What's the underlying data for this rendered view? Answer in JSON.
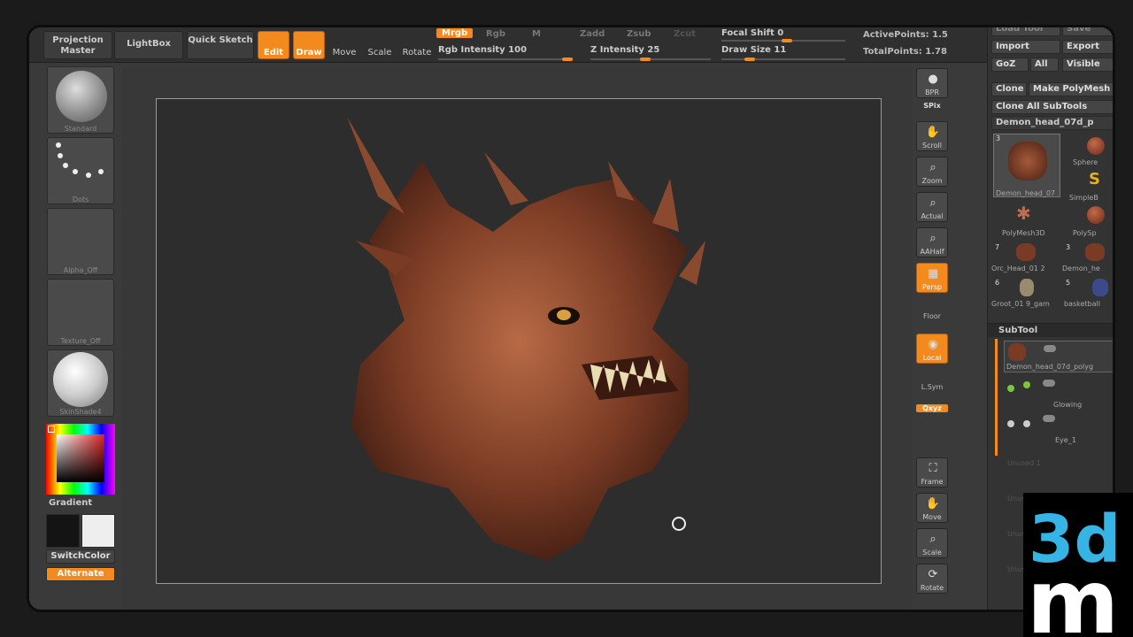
{
  "topbar": {
    "projection_master": "Projection Master",
    "lightbox": "LightBox",
    "quick_sketch": "Quick Sketch",
    "edit": "Edit",
    "draw": "Draw",
    "move": "Move",
    "scale": "Scale",
    "rotate": "Rotate",
    "mrgb": "Mrgb",
    "rgb": "Rgb",
    "m": "M",
    "rgb_intensity": "Rgb Intensity 100",
    "zadd": "Zadd",
    "zsub": "Zsub",
    "zcut": "Zcut",
    "z_intensity": "Z Intensity 25",
    "focal_shift": "Focal Shift 0",
    "draw_size": "Draw Size 11",
    "active_points": "ActivePoints: 1.5",
    "total_points": "TotalPoints: 1.78"
  },
  "left": {
    "standard": "Standard",
    "dots": "Dots",
    "alpha": "Alpha_Off",
    "texture": "Texture_Off",
    "material": "SkinShade4",
    "gradient": "Gradient",
    "switch_color": "SwitchColor",
    "alternate": "Alternate"
  },
  "right_strip": {
    "bpr": "BPR",
    "spix": "SPix",
    "scroll": "Scroll",
    "zoom": "Zoom",
    "actual": "Actual",
    "aahalf": "AAHalf",
    "persp": "Persp",
    "floor": "Floor",
    "local": "Local",
    "lsym": "L.Sym",
    "xyz": "Qxyz",
    "frame": "Frame",
    "move": "Move",
    "scale": "Scale",
    "rotate": "Rotate"
  },
  "panel": {
    "load_tool": "Load Tool",
    "save": "Save",
    "import": "Import",
    "export": "Export",
    "goz": "GoZ",
    "all": "All",
    "visible": "Visible",
    "clone": "Clone",
    "make_polymesh": "Make PolyMesh",
    "clone_all": "Clone All SubTools",
    "current_tool": "Demon_head_07d_p",
    "tools": [
      {
        "label": "Demon_head_07",
        "count": "3"
      },
      {
        "label": "Sphere",
        "count": ""
      },
      {
        "label": "SimpleB",
        "count": ""
      },
      {
        "label": "PolyMesh3D",
        "count": ""
      },
      {
        "label": "PolySp",
        "count": ""
      },
      {
        "label": "Orc_Head_01 2",
        "count": "7"
      },
      {
        "label": "Demon_he",
        "count": "3"
      },
      {
        "label": "Groot_01 9_gam",
        "count": "6"
      },
      {
        "label": "basketball",
        "count": "5"
      }
    ],
    "subtool_header": "SubTool",
    "subtools": [
      "Demon_head_07d_polyg",
      "Glowing",
      "Eye_1"
    ],
    "dim_rows": [
      "Unused 1",
      "Unused",
      "Unused",
      "Unused"
    ]
  },
  "colors": {
    "accent": "#f28a1e"
  }
}
